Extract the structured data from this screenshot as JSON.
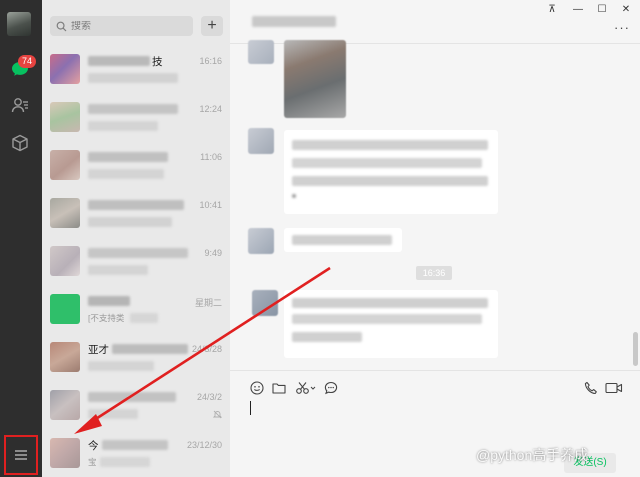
{
  "sidebar": {
    "unread_badge": "74",
    "icons": [
      "avatar",
      "chat-icon",
      "contacts-icon",
      "box-icon",
      "menu-icon"
    ],
    "accent": "#07c160",
    "highlight_color": "#e02020"
  },
  "search": {
    "placeholder": "搜索",
    "add_label": "+"
  },
  "chats": [
    {
      "name": "技",
      "time": "16:16",
      "preview": ""
    },
    {
      "name": "",
      "time": "12:24",
      "preview": ""
    },
    {
      "name": "",
      "time": "11:06",
      "preview": ""
    },
    {
      "name": "",
      "time": "10:41",
      "preview": ""
    },
    {
      "name": "",
      "time": "9:49",
      "preview": ""
    },
    {
      "name": "",
      "time": "星期二",
      "preview": "[不支持类"
    },
    {
      "name": "亚才",
      "time": "24/3/28",
      "preview": ""
    },
    {
      "name": "",
      "time": "24/3/2",
      "preview": ""
    },
    {
      "name": "今",
      "time": "23/12/30",
      "preview": "宝"
    }
  ],
  "conversation": {
    "time_divider": "16:36"
  },
  "window_controls": {
    "pin": "⊼",
    "minimize": "—",
    "maximize": "☐",
    "close": "✕",
    "more": "···"
  },
  "composer": {
    "send_label": "发送(S)"
  },
  "watermark": "@python高手养成",
  "annotation": {
    "color": "#e02020"
  }
}
